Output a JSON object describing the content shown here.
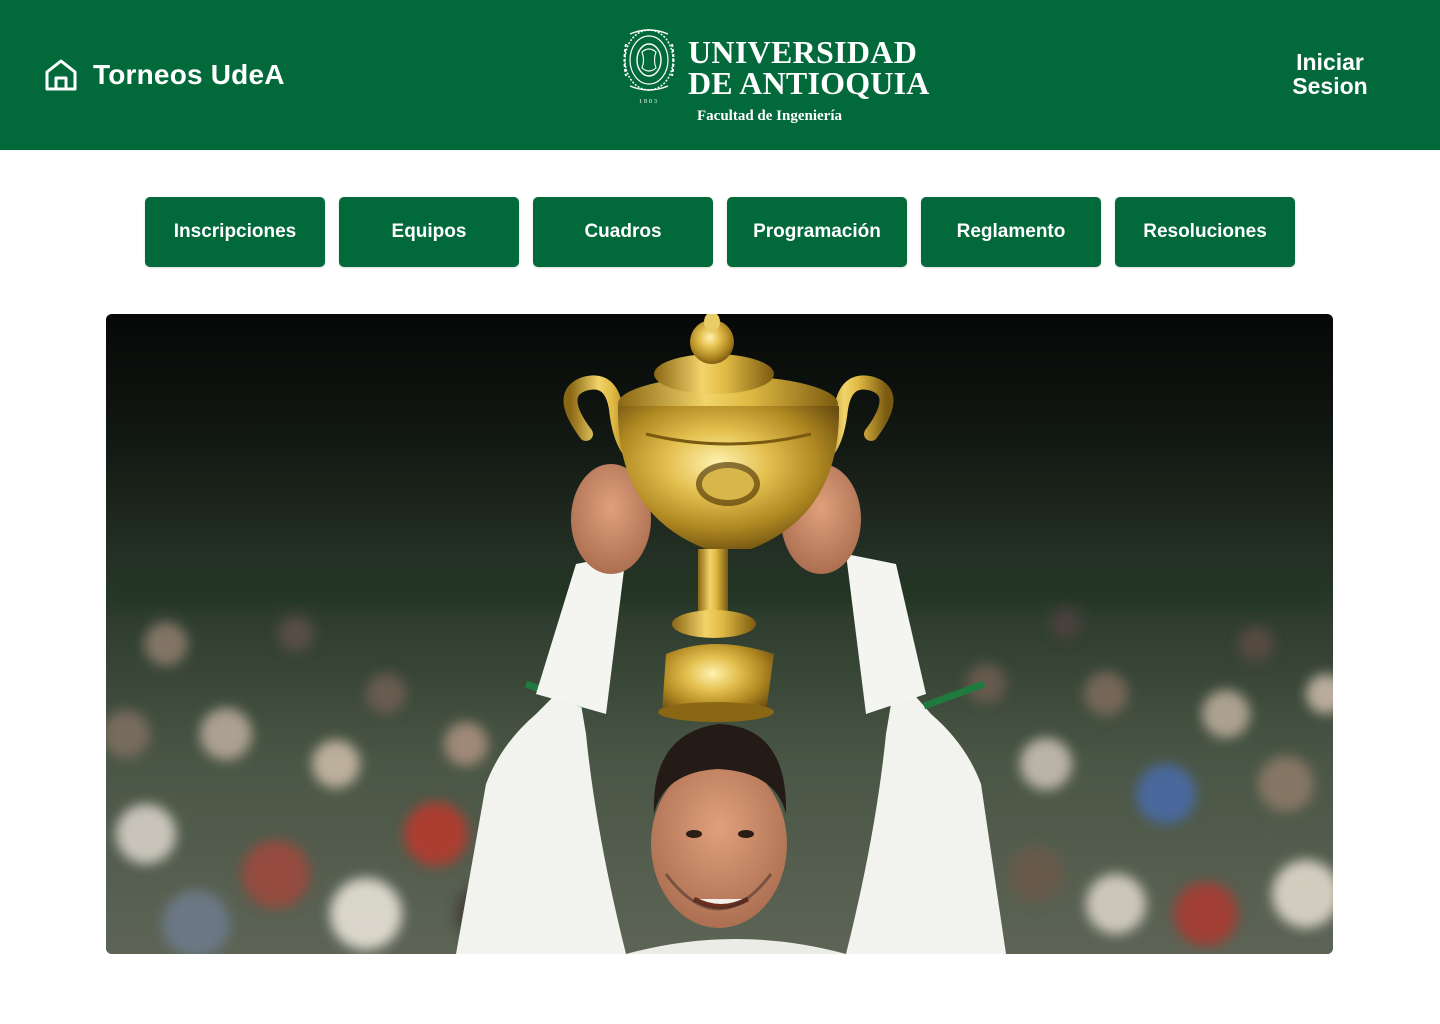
{
  "header": {
    "site_title": "Torneos UdeA",
    "home_icon": "home-icon",
    "logo": {
      "line1": "UNIVERSIDAD",
      "line2": "DE ANTIOQUIA",
      "subtitle": "Facultad de Ingeniería",
      "seal_year": "1803"
    },
    "login": {
      "line1": "Iniciar",
      "line2": "Sesion"
    }
  },
  "nav": {
    "items": [
      {
        "label": "Inscripciones"
      },
      {
        "label": "Equipos"
      },
      {
        "label": "Cuadros"
      },
      {
        "label": "Programación"
      },
      {
        "label": "Reglamento"
      },
      {
        "label": "Resoluciones"
      }
    ]
  },
  "theme": {
    "brand_green": "#026a3a",
    "text_on_brand": "#ffffff",
    "page_background": "#ffffff"
  }
}
